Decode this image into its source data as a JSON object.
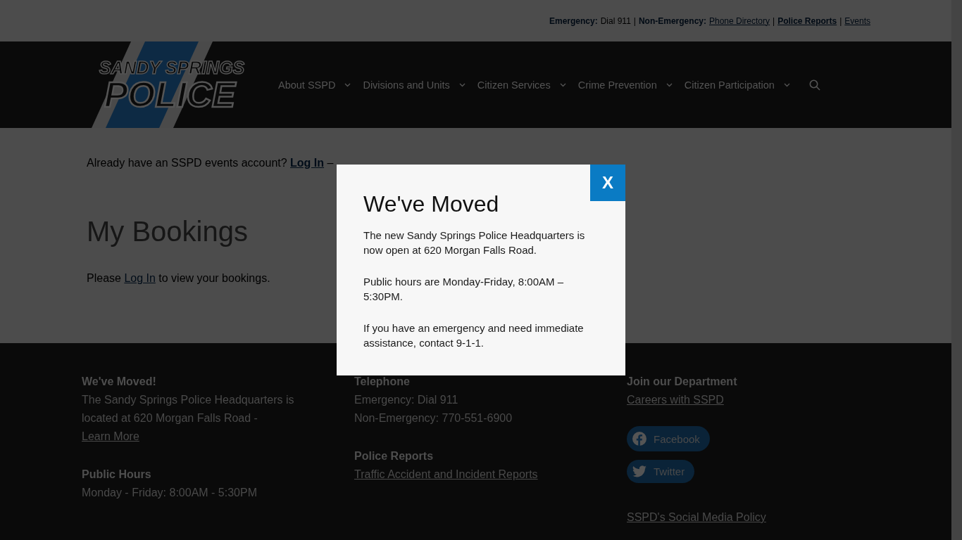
{
  "top_bar": [
    {
      "kind": "label",
      "text": "Emergency:"
    },
    {
      "kind": "text",
      "text": "Dial 911"
    },
    {
      "kind": "sep",
      "text": "|"
    },
    {
      "kind": "label",
      "text": "Non-Emergency:"
    },
    {
      "kind": "link",
      "text": "Phone Directory"
    },
    {
      "kind": "sep",
      "text": "|"
    },
    {
      "kind": "boldlink",
      "text": "Police Reports"
    },
    {
      "kind": "sep",
      "text": "|"
    },
    {
      "kind": "link",
      "text": "Events"
    }
  ],
  "logo": {
    "line_1": "SANDY SPRINGS",
    "line_2": "POLICE"
  },
  "nav": [
    {
      "label": "About SSPD",
      "has_menu": true
    },
    {
      "label": "Divisions and Units",
      "has_menu": true
    },
    {
      "label": "Citizen Services",
      "has_menu": true
    },
    {
      "label": "Crime Prevention",
      "has_menu": true
    },
    {
      "label": "Citizen Participation",
      "has_menu": true
    }
  ],
  "account_line": {
    "before": "Already have an SSPD events account?",
    "link": "Log In",
    "after": "–"
  },
  "page_title": "My Bookings",
  "login_line": {
    "before": "Please",
    "link": "Log In",
    "after": "to view your bookings."
  },
  "footer": {
    "columns": [
      {
        "blocks": [
          {
            "heading": "We've Moved!",
            "lines": [
              {
                "kind": "text_link",
                "text": "The Sandy Springs Police Headquarters is located at 620 Morgan Falls Road -",
                "link": "Learn More"
              }
            ]
          },
          {
            "heading": "Public Hours",
            "lines": [
              {
                "kind": "text",
                "text": "Monday - Friday: 8:00AM - 5:30PM"
              }
            ]
          }
        ]
      },
      {
        "blocks": [
          {
            "heading": "Telephone",
            "lines": [
              {
                "kind": "text",
                "text": "Emergency: Dial 911"
              },
              {
                "kind": "text",
                "text": "Non-Emergency: 770-551-6900"
              }
            ]
          },
          {
            "heading": "Police Reports",
            "lines": [
              {
                "kind": "link",
                "text": "Traffic Accident and Incident Reports"
              }
            ]
          }
        ]
      },
      {
        "blocks": [
          {
            "heading": "Join our Department",
            "lines": [
              {
                "kind": "link",
                "text": "Careers with SSPD"
              }
            ]
          }
        ],
        "social": [
          {
            "kind": "facebook",
            "label": "Facebook"
          },
          {
            "kind": "twitter",
            "label": "Twitter"
          }
        ],
        "policy_link": "SSPD's Social Media Policy"
      }
    ]
  },
  "modal": {
    "title": "We've Moved",
    "close": "X",
    "paragraphs": [
      "The new Sandy Springs Police Headquarters is now open at 620 Morgan Falls Road.",
      "Public hours are Monday-Friday, 8:00AM – 5:30PM.",
      "If you have an emergency and need immediate assistance, contact 9-1-1."
    ]
  }
}
